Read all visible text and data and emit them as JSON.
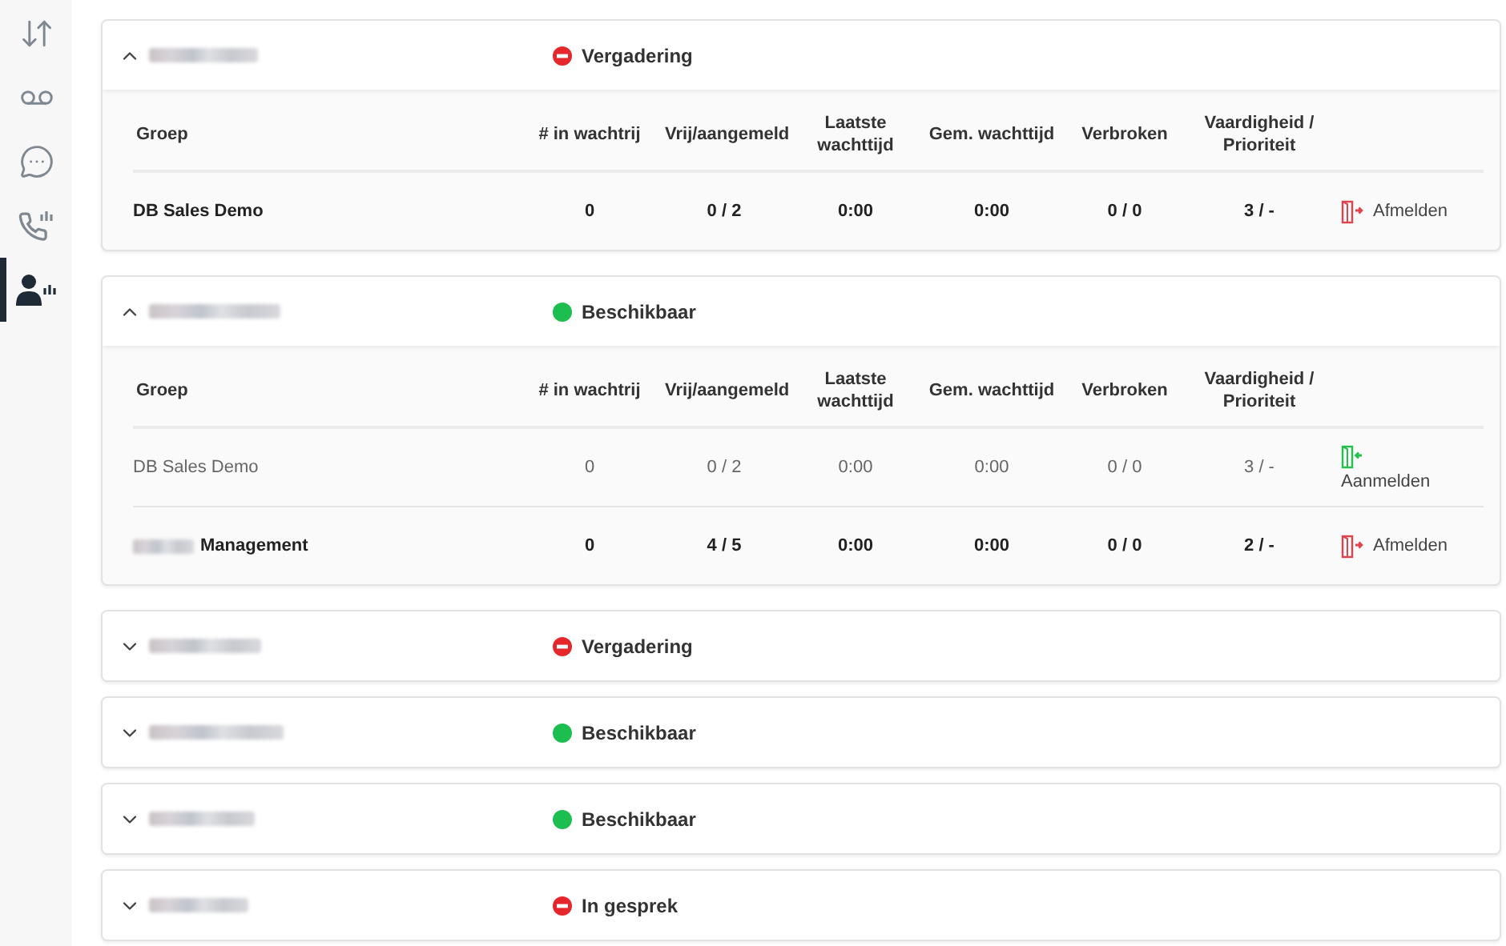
{
  "sidebar": {
    "items": [
      {
        "kind": "transfer",
        "selected": false
      },
      {
        "kind": "voicemail",
        "selected": false
      },
      {
        "kind": "chat",
        "selected": false
      },
      {
        "kind": "call-stats",
        "selected": false
      },
      {
        "kind": "agent-stats",
        "selected": true
      }
    ]
  },
  "agents": [
    {
      "expanded": true,
      "status": {
        "kind": "busy",
        "label": "Vergadering"
      },
      "columns": [
        "Groep",
        "# in wachtrij",
        "Vrij/aangemeld",
        "Laatste wachttijd",
        "Gem. wachttijd",
        "Verbroken",
        "Vaardigheid / Prioriteit"
      ],
      "groups": [
        {
          "name": "DB Sales Demo",
          "name_redacted_prefix": false,
          "logged_in": true,
          "cells": [
            "0",
            "0 / 2",
            "0:00",
            "0:00",
            "0 / 0",
            "3 / -"
          ],
          "action": {
            "kind": "logout",
            "label": "Afmelden"
          }
        }
      ]
    },
    {
      "expanded": true,
      "status": {
        "kind": "available",
        "label": "Beschikbaar"
      },
      "columns": [
        "Groep",
        "# in wachtrij",
        "Vrij/aangemeld",
        "Laatste wachttijd",
        "Gem. wachttijd",
        "Verbroken",
        "Vaardigheid / Prioriteit"
      ],
      "groups": [
        {
          "name": "DB Sales Demo",
          "name_redacted_prefix": false,
          "logged_in": false,
          "cells": [
            "0",
            "0 / 2",
            "0:00",
            "0:00",
            "0 / 0",
            "3 / -"
          ],
          "action": {
            "kind": "login",
            "label": "Aanmelden"
          }
        },
        {
          "name": "Management",
          "name_redacted_prefix": true,
          "logged_in": true,
          "cells": [
            "0",
            "4 / 5",
            "0:00",
            "0:00",
            "0 / 0",
            "2 / -"
          ],
          "action": {
            "kind": "logout",
            "label": "Afmelden"
          }
        }
      ]
    },
    {
      "expanded": false,
      "status": {
        "kind": "busy",
        "label": "Vergadering"
      }
    },
    {
      "expanded": false,
      "status": {
        "kind": "available",
        "label": "Beschikbaar"
      }
    },
    {
      "expanded": false,
      "status": {
        "kind": "available",
        "label": "Beschikbaar"
      }
    },
    {
      "expanded": false,
      "status": {
        "kind": "busy",
        "label": "In gesprek"
      }
    }
  ]
}
